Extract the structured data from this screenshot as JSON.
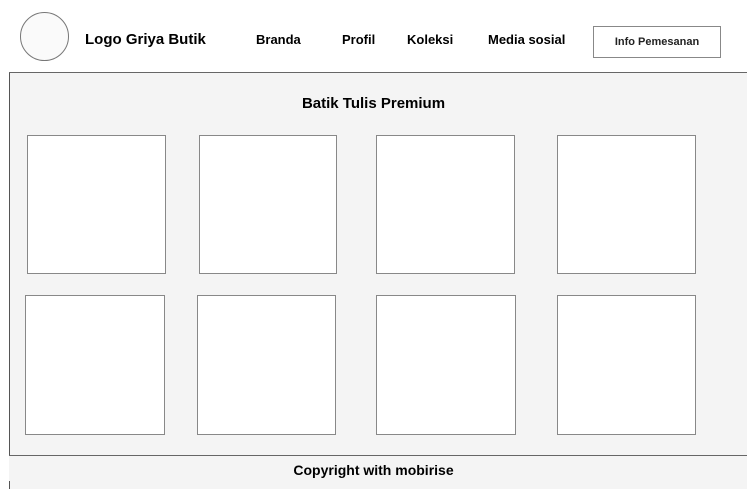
{
  "header": {
    "logo_text": "Logo Griya Butik",
    "nav": [
      "Branda",
      "Profil",
      "Koleksi",
      "Media sosial"
    ],
    "order_button": "Info Pemesanan"
  },
  "main": {
    "section_title": "Batik Tulis Premium",
    "product_count_rows": 2,
    "product_count_cols": 4
  },
  "footer": {
    "text": "Copyright with mobirise"
  }
}
